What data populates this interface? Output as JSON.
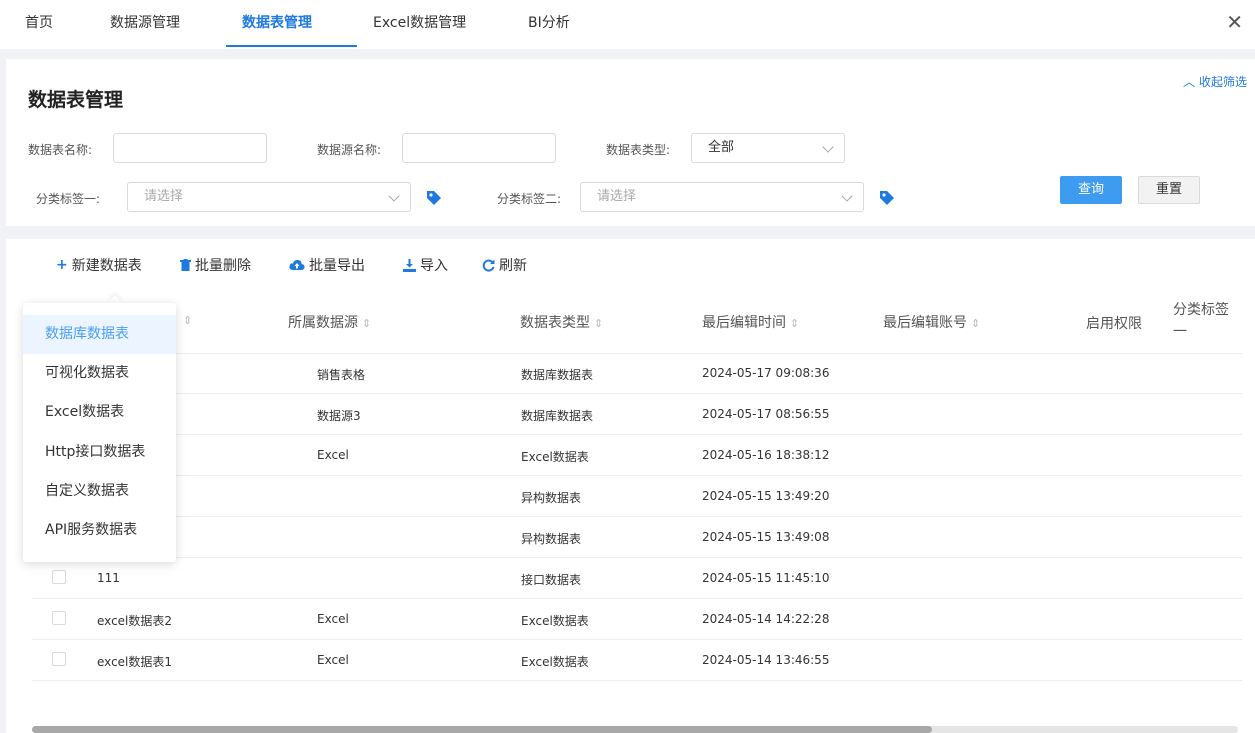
{
  "tabs": [
    "首页",
    "数据源管理",
    "数据表管理",
    "Excel数据管理",
    "BI分析"
  ],
  "close_label": "✕",
  "filter": {
    "title": "数据表管理",
    "collapse_label": "收起筛选",
    "table_name_label": "数据表名称:",
    "datasource_name_label": "数据源名称:",
    "table_type_label": "数据表类型:",
    "table_type_value": "全部",
    "tag1_label": "分类标签一:",
    "tag1_placeholder": "请选择",
    "tag2_label": "分类标签二:",
    "tag2_placeholder": "请选择",
    "query_label": "查询",
    "reset_label": "重置"
  },
  "toolbar": {
    "new_label": "新建数据表",
    "batch_delete_label": "批量删除",
    "batch_export_label": "批量导出",
    "import_label": "导入",
    "refresh_label": "刷新"
  },
  "table": {
    "headers": [
      "所属数据源",
      "数据表类型",
      "最后编辑时间",
      "最后编辑账号",
      "启用权限",
      "分类标签一"
    ],
    "rows": [
      {
        "name": "",
        "source": "销售表格",
        "type": "数据库数据表",
        "time": "2024-05-17 09:08:36"
      },
      {
        "name": "",
        "source": "数据源3",
        "type": "数据库数据表",
        "time": "2024-05-17 08:56:55"
      },
      {
        "name": "",
        "source": "Excel",
        "type": "Excel数据表",
        "time": "2024-05-16 18:38:12"
      },
      {
        "name": "",
        "source": "",
        "type": "异构数据表",
        "time": "2024-05-15 13:49:20"
      },
      {
        "name": "",
        "source": "",
        "type": "异构数据表",
        "time": "2024-05-15 13:49:08"
      },
      {
        "name": "111",
        "source": "",
        "type": "接口数据表",
        "time": "2024-05-15 11:45:10"
      },
      {
        "name": "excel数据表2",
        "source": "Excel",
        "type": "Excel数据表",
        "time": "2024-05-14 14:22:28"
      },
      {
        "name": "excel数据表1",
        "source": "Excel",
        "type": "Excel数据表",
        "time": "2024-05-14 13:46:55"
      }
    ]
  },
  "dropdown": {
    "items": [
      "数据库数据表",
      "可视化数据表",
      "Excel数据表",
      "Http接口数据表",
      "自定义数据表",
      "API服务数据表"
    ]
  },
  "colors": {
    "accent": "#1f7ae0",
    "primary_button": "#3d9bf0",
    "menu_active_bg": "#ecf5ff"
  }
}
